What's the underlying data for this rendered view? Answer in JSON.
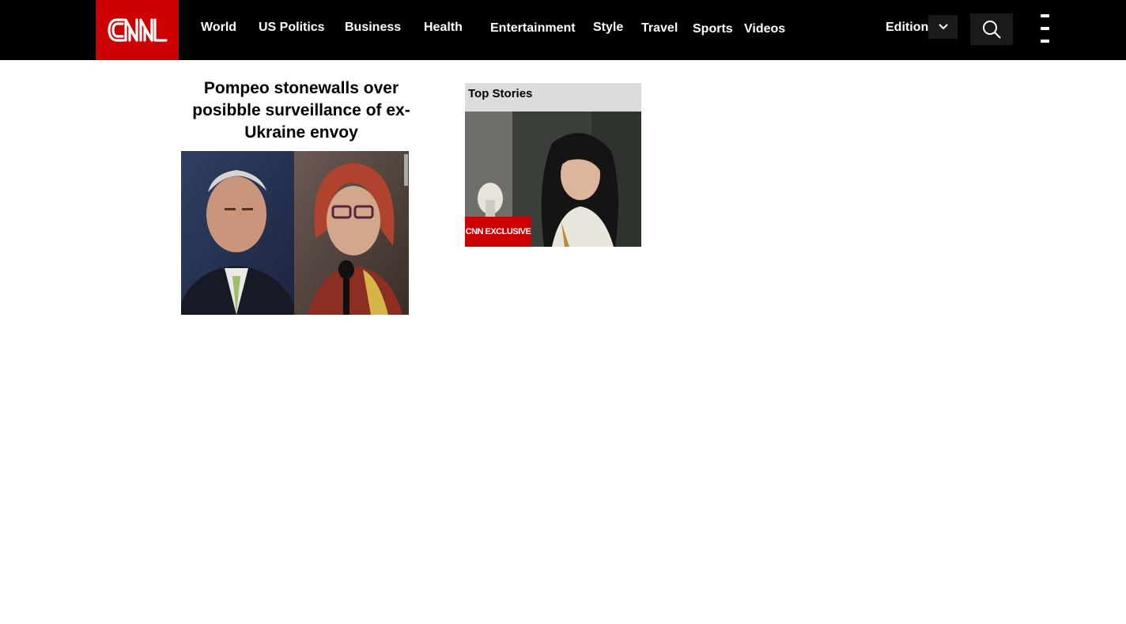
{
  "brand": {
    "logo_text": "CNN",
    "color": "#cc0000"
  },
  "nav": {
    "items": [
      {
        "label": "World"
      },
      {
        "label": "US Politics"
      },
      {
        "label": "Business"
      },
      {
        "label": "Health"
      },
      {
        "label": "Entertainment"
      },
      {
        "label": "Style"
      },
      {
        "label": "Travel"
      },
      {
        "label": "Sports"
      },
      {
        "label": "Videos"
      }
    ],
    "edition_label": "Edition",
    "icons": {
      "dropdown": "chevron-down-icon",
      "search": "search-icon",
      "menu": "hamburger-menu-icon"
    }
  },
  "main_story": {
    "headline": "Pompeo stonewalls over posibble surveillance of ex-Ukraine envoy"
  },
  "top_stories": {
    "title": "Top Stories",
    "badge": "CNN EXCLUSIVE"
  }
}
